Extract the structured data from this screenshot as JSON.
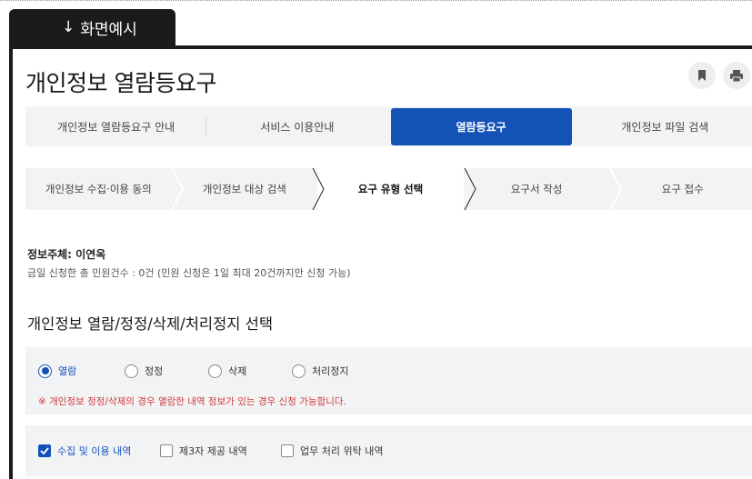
{
  "example_tab": {
    "arrow": "↓",
    "label": "화면예시"
  },
  "page": {
    "title": "개인정보 열람등요구"
  },
  "icons": {
    "bookmark": "bookmark-icon",
    "print": "print-icon"
  },
  "main_tabs": [
    {
      "label": "개인정보 열람등요구 안내",
      "active": false
    },
    {
      "label": "서비스 이용안내",
      "active": false
    },
    {
      "label": "열람등요구",
      "active": true
    },
    {
      "label": "개인정보 파일 검색",
      "active": false
    }
  ],
  "steps": [
    {
      "label": "개인정보 수집·이용 동의",
      "active": false
    },
    {
      "label": "개인정보 대상 검색",
      "active": false
    },
    {
      "label": "요구 유형 선택",
      "active": true
    },
    {
      "label": "요구서 작성",
      "active": false
    },
    {
      "label": "요구 접수",
      "active": false
    }
  ],
  "subject": {
    "label": "정보주체: 이연옥",
    "info": "금일 신청한 총 민원건수 : 0건 (민원 신청은 1일 최대 20건까지만 신청 가능)"
  },
  "section": {
    "title": "개인정보 열람/정정/삭제/처리정지 선택"
  },
  "request_types": [
    {
      "label": "열람",
      "checked": true
    },
    {
      "label": "정정",
      "checked": false
    },
    {
      "label": "삭제",
      "checked": false
    },
    {
      "label": "처리정지",
      "checked": false
    }
  ],
  "notice": "※ 개인정보 정정/삭제의 경우 열람한 내역 정보가 있는 경우 신청 가능합니다.",
  "detail_types": [
    {
      "label": "수집 및 이용 내역",
      "checked": true
    },
    {
      "label": "제3자 제공 내역",
      "checked": false
    },
    {
      "label": "업무 처리 위탁 내역",
      "checked": false
    }
  ],
  "colors": {
    "accent": "#1552b8",
    "notice": "#d23a3a",
    "panel": "#f2f3f5",
    "dark": "#1b1b1b"
  }
}
